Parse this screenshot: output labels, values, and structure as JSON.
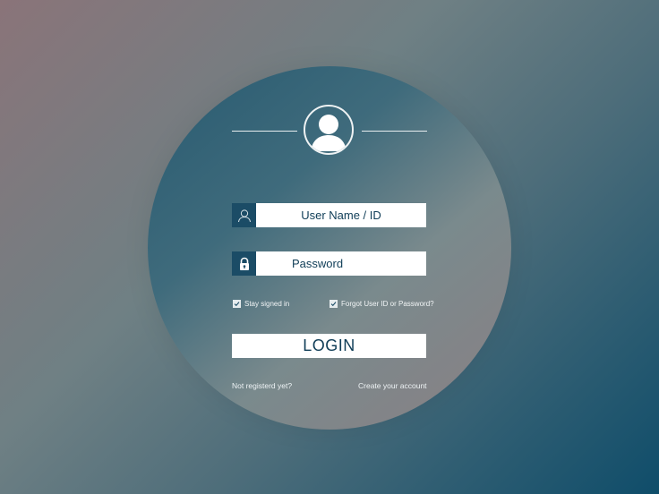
{
  "colors": {
    "accent": "#1b4c66",
    "text_dark": "#0f3d57",
    "panel_white": "#ffffff"
  },
  "avatar": {
    "icon": "user-avatar-icon"
  },
  "form": {
    "username": {
      "placeholder": "User Name / ID",
      "value": "",
      "icon": "user-icon"
    },
    "password": {
      "placeholder": "Password",
      "value": "",
      "icon": "lock-icon"
    },
    "stay_signed_in": {
      "label": "Stay signed in",
      "checked": true
    },
    "forgot": {
      "label": "Forgot User ID or Password?",
      "checked": true
    },
    "login_label": "LOGIN"
  },
  "footer": {
    "not_registered": "Not registerd yet?",
    "create_account": "Create your account"
  }
}
